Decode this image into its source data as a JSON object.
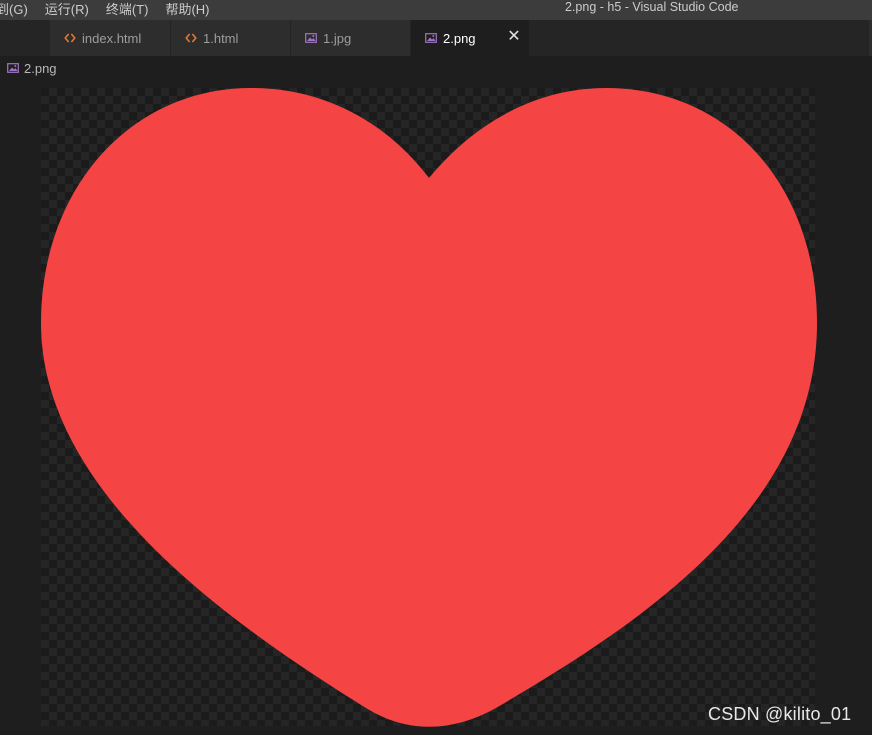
{
  "menu": {
    "items": [
      "到(G)",
      "运行(R)",
      "终端(T)",
      "帮助(H)"
    ]
  },
  "window": {
    "title": "2.png - h5 - Visual Studio Code"
  },
  "tabs": [
    {
      "label": "index.html",
      "icon": "html-code-icon",
      "active": false
    },
    {
      "label": "1.html",
      "icon": "html-code-icon",
      "active": false
    },
    {
      "label": "1.jpg",
      "icon": "image-file-icon",
      "active": false
    },
    {
      "label": "2.png",
      "icon": "image-file-icon",
      "active": true,
      "close": "✕"
    }
  ],
  "breadcrumb": {
    "file": "2.png",
    "icon": "image-file-icon"
  },
  "preview": {
    "image_name": "2.png",
    "subject": "heart-shape",
    "fill_color": "#f44444",
    "background": "transparent-checkerboard"
  },
  "watermark": {
    "text": "CSDN @kilito_01"
  },
  "colors": {
    "html_icon": "#e37933",
    "image_icon": "#a074c4",
    "titlebar": "#3c3c3c",
    "tab_inactive": "#2d2d2d",
    "editor_bg": "#1e1e1e"
  }
}
